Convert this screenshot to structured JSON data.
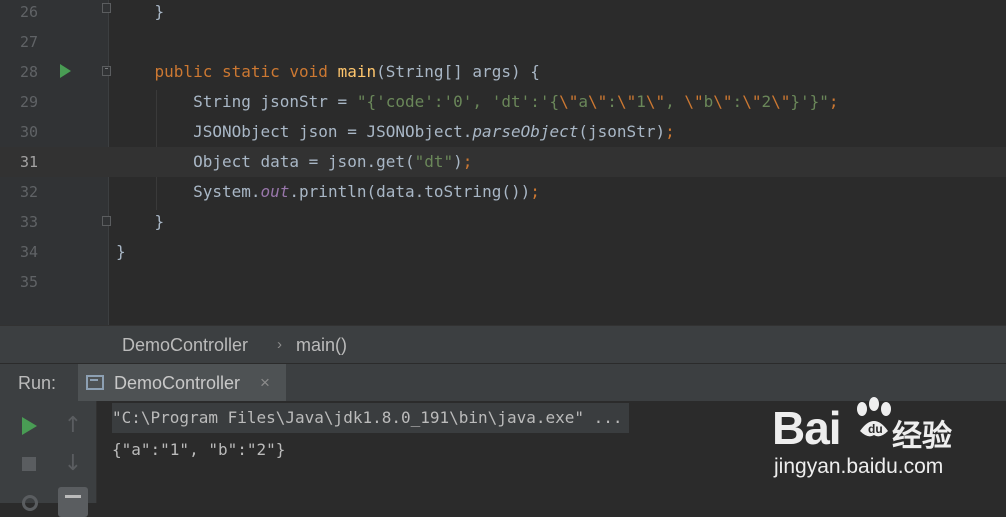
{
  "editor": {
    "lines": [
      {
        "num": "26",
        "tokens": [
          {
            "t": "    }",
            "c": ""
          }
        ]
      },
      {
        "num": "27",
        "tokens": []
      },
      {
        "num": "28",
        "tokens": [
          {
            "t": "    ",
            "c": ""
          },
          {
            "t": "public static void ",
            "c": "kw"
          },
          {
            "t": "main",
            "c": "fn"
          },
          {
            "t": "(String[] args) {",
            "c": ""
          }
        ]
      },
      {
        "num": "29",
        "tokens": [
          {
            "t": "        String jsonStr = ",
            "c": ""
          },
          {
            "t": "\"{'code':'0', 'dt':'{",
            "c": "str"
          },
          {
            "t": "\\\"",
            "c": "esc"
          },
          {
            "t": "a",
            "c": "str"
          },
          {
            "t": "\\\"",
            "c": "esc"
          },
          {
            "t": ":",
            "c": "str"
          },
          {
            "t": "\\\"",
            "c": "esc"
          },
          {
            "t": "1",
            "c": "str"
          },
          {
            "t": "\\\"",
            "c": "esc"
          },
          {
            "t": ", ",
            "c": "str"
          },
          {
            "t": "\\\"",
            "c": "esc"
          },
          {
            "t": "b",
            "c": "str"
          },
          {
            "t": "\\\"",
            "c": "esc"
          },
          {
            "t": ":",
            "c": "str"
          },
          {
            "t": "\\\"",
            "c": "esc"
          },
          {
            "t": "2",
            "c": "str"
          },
          {
            "t": "\\\"",
            "c": "esc"
          },
          {
            "t": "}'}\"",
            "c": "str"
          },
          {
            "t": ";",
            "c": "kw"
          }
        ]
      },
      {
        "num": "30",
        "tokens": [
          {
            "t": "        JSONObject json = JSONObject.",
            "c": ""
          },
          {
            "t": "parseObject",
            "c": "it"
          },
          {
            "t": "(jsonStr)",
            "c": ""
          },
          {
            "t": ";",
            "c": "kw"
          }
        ]
      },
      {
        "num": "31",
        "tokens": [
          {
            "t": "        Object data = json.get(",
            "c": ""
          },
          {
            "t": "\"dt\"",
            "c": "str"
          },
          {
            "t": ")",
            "c": ""
          },
          {
            "t": ";",
            "c": "kw"
          }
        ]
      },
      {
        "num": "32",
        "tokens": [
          {
            "t": "        System.",
            "c": ""
          },
          {
            "t": "out",
            "c": "field"
          },
          {
            "t": ".println(data.toString())",
            "c": ""
          },
          {
            "t": ";",
            "c": "kw"
          }
        ]
      },
      {
        "num": "33",
        "tokens": [
          {
            "t": "    }",
            "c": ""
          }
        ]
      },
      {
        "num": "34",
        "tokens": [
          {
            "t": "}",
            "c": ""
          }
        ]
      },
      {
        "num": "35",
        "tokens": []
      }
    ],
    "current_line": "31"
  },
  "breadcrumb": {
    "class_name": "DemoController",
    "separator": "›",
    "method_name": "main()"
  },
  "run_panel": {
    "label": "Run:",
    "tab_label": "DemoController",
    "tab_close": "×"
  },
  "console": {
    "lines": [
      "\"C:\\Program Files\\Java\\jdk1.8.0_191\\bin\\java.exe\" ...",
      "{\"a\":\"1\", \"b\":\"2\"}"
    ]
  },
  "watermark": {
    "brand": "Bai",
    "brand_cn": "经验",
    "url": "jingyan.baidu.com"
  },
  "colors": {
    "background": "#2b2b2b",
    "keyword": "#cc7832",
    "function": "#ffc66d",
    "string": "#6a8759",
    "field": "#9876aa",
    "run_green": "#499c54"
  }
}
